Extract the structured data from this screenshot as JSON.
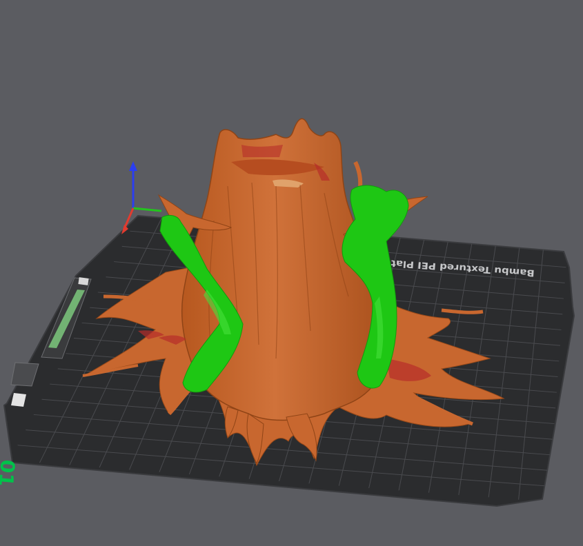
{
  "viewport": {
    "background_color": "#5b5c61",
    "plate_color": "#2b2c2e",
    "grid_color": "#4a4b4f",
    "plate_label": "Bambu Textured PEI Plate",
    "plate_number": "01",
    "model_colors": {
      "primary_filament": "#c8672f",
      "support_filament": "#1ec714",
      "overhang_highlight": "#b62d2a"
    },
    "axis_colors": {
      "x": "#e23b2f",
      "y": "#23c41e",
      "z": "#2b3ef0"
    }
  }
}
